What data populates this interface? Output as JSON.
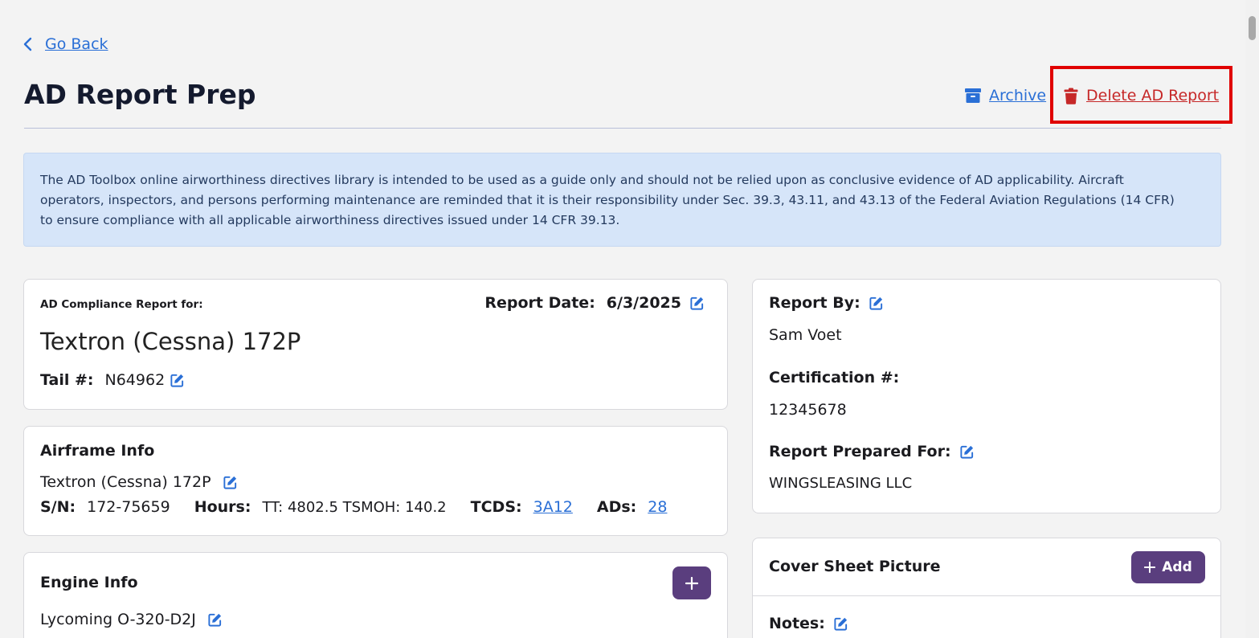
{
  "nav": {
    "go_back": "Go Back"
  },
  "header": {
    "title": "AD Report Prep",
    "archive_label": "Archive",
    "delete_label": "Delete AD Report"
  },
  "disclaimer": {
    "line1": "The AD Toolbox online airworthiness directives library is intended to be used as a guide only and should not be relied upon as conclusive evidence of AD applicability. Aircraft",
    "line2": "operators, inspectors, and persons performing maintenance are reminded that it is their responsibility under Sec. 39.3, 43.11, and 43.13 of the Federal Aviation Regulations (14 CFR)",
    "line3": "to ensure compliance with all applicable airworthiness directives issued under 14 CFR 39.13."
  },
  "report_card": {
    "for_label": "AD Compliance Report for:",
    "date_label": "Report Date:",
    "date_value": "6/3/2025",
    "aircraft": "Textron (Cessna) 172P",
    "tail_label": "Tail #:",
    "tail_value": "N64962"
  },
  "airframe": {
    "title": "Airframe Info",
    "model": "Textron (Cessna) 172P",
    "sn_label": "S/N:",
    "sn_value": "172-75659",
    "hours_label": "Hours:",
    "hours_value": "TT: 4802.5 TSMOH: 140.2",
    "tcds_label": "TCDS:",
    "tcds_value": "3A12",
    "ads_label": "ADs:",
    "ads_value": "28"
  },
  "engine": {
    "title": "Engine Info",
    "model": "Lycoming O-320-D2J"
  },
  "report_by": {
    "label": "Report By:",
    "name": "Sam Voet",
    "cert_label": "Certification #:",
    "cert_value": "12345678",
    "prepared_label": "Report Prepared For:",
    "prepared_value": "WINGSLEASING LLC"
  },
  "cover": {
    "title": "Cover Sheet Picture",
    "add_label": "Add",
    "notes_label": "Notes:"
  },
  "colors": {
    "accent": "#2a6fd6",
    "danger": "#c62828",
    "purple": "#5a3e7e",
    "highlight": "#e00000",
    "banner": "#d6e5f9"
  }
}
